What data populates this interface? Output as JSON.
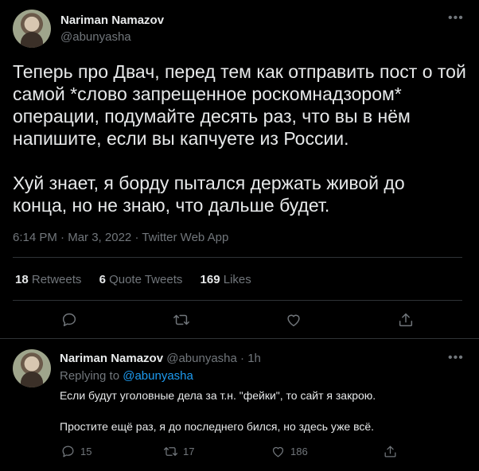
{
  "main_tweet": {
    "author_name": "Nariman Namazov",
    "author_handle": "@abunyasha",
    "text": "Теперь про Двач, перед тем как отправить пост о той\nсамой *слово запрещенное роскомнадзором*\nоперации, подумайте десять раз, что вы в нём\nнапишите, если вы капчуете из России.\n\nХуй знает, я борду пытался держать живой до\nконца, но не знаю, что дальше будет.",
    "time": "6:14 PM",
    "date": "Mar 3, 2022",
    "source": "Twitter Web App",
    "retweets_count": "18",
    "retweets_label": "Retweets",
    "quotes_count": "6",
    "quotes_label": "Quote Tweets",
    "likes_count": "169",
    "likes_label": "Likes"
  },
  "reply": {
    "author_name": "Nariman Namazov",
    "author_handle": "@abunyasha",
    "age": "1h",
    "replying_prefix": "Replying to",
    "replying_to": "@abunyasha",
    "line1": "Если будут уголовные дела за т.н. \"фейки\", то сайт я закрою.",
    "line2": "Простите ещё раз, я до последнего бился, но здесь уже всё.",
    "replies_count": "15",
    "retweets_count": "17",
    "likes_count": "186"
  },
  "separators": {
    "dot": "·"
  },
  "icons": {
    "more": "more-icon",
    "reply": "reply-icon",
    "retweet": "retweet-icon",
    "like": "heart-icon",
    "share": "share-icon"
  },
  "colors": {
    "background": "#000000",
    "text": "#e7e9ea",
    "secondary": "#71767b",
    "link": "#1d9bf0",
    "divider": "#2f3336"
  }
}
